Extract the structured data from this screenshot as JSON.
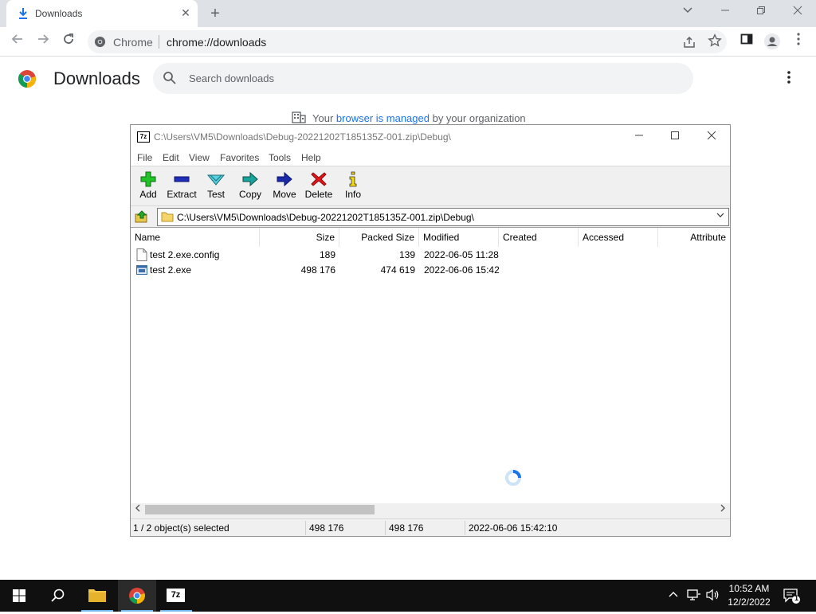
{
  "browser": {
    "tab_title": "Downloads",
    "tab_close": "✕",
    "new_tab": "+",
    "site_chip": "Chrome",
    "url": "chrome://downloads"
  },
  "downloads_page": {
    "title": "Downloads",
    "search_placeholder": "Search downloads",
    "managed_prefix": "Your",
    "managed_link": "browser is managed",
    "managed_suffix": "by your organization"
  },
  "zip_window": {
    "title": "C:\\Users\\VM5\\Downloads\\Debug-20221202T185135Z-001.zip\\Debug\\",
    "menu": [
      "File",
      "Edit",
      "View",
      "Favorites",
      "Tools",
      "Help"
    ],
    "toolbar": [
      {
        "label": "Add",
        "icon": "add-icon"
      },
      {
        "label": "Extract",
        "icon": "extract-icon"
      },
      {
        "label": "Test",
        "icon": "test-icon"
      },
      {
        "label": "Copy",
        "icon": "copy-icon"
      },
      {
        "label": "Move",
        "icon": "move-icon"
      },
      {
        "label": "Delete",
        "icon": "delete-icon"
      },
      {
        "label": "Info",
        "icon": "info-icon"
      }
    ],
    "address": "C:\\Users\\VM5\\Downloads\\Debug-20221202T185135Z-001.zip\\Debug\\",
    "columns": [
      "Name",
      "Size",
      "Packed Size",
      "Modified",
      "Created",
      "Accessed",
      "Attribute"
    ],
    "files": [
      {
        "name": "test 2.exe.config",
        "size": "189",
        "packed": "139",
        "modified": "2022-06-05 11:28",
        "icon": "file-icon"
      },
      {
        "name": "test 2.exe",
        "size": "498 176",
        "packed": "474 619",
        "modified": "2022-06-06 15:42",
        "icon": "exe-icon"
      }
    ],
    "status": {
      "selected": "1 / 2 object(s) selected",
      "size": "498 176",
      "packed": "498 176",
      "modified": "2022-06-06 15:42:10"
    }
  },
  "taskbar": {
    "time": "10:52 AM",
    "date": "12/2/2022",
    "notification_count": "1",
    "zip_label": "7z"
  },
  "colors": {
    "chrome_blue": "#1a73e8",
    "taskbar": "#101010",
    "accent": "#76b9ed"
  }
}
